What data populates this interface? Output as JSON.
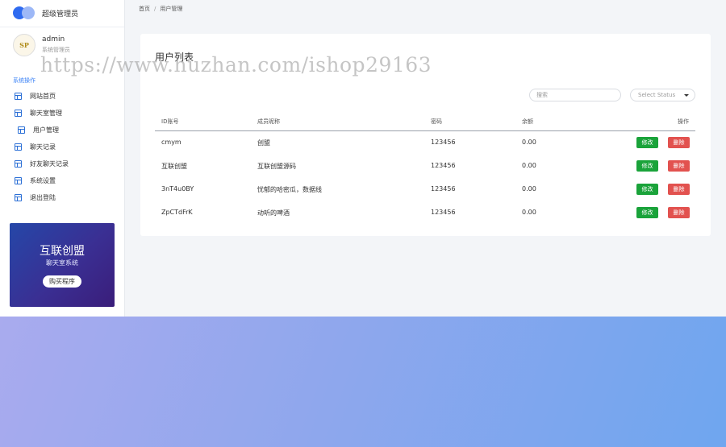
{
  "brand": {
    "title": "超级管理员"
  },
  "user": {
    "avatar_text": "SP",
    "name": "admin",
    "role": "系统管理员"
  },
  "sidebar": {
    "section_label": "系统操作",
    "items": [
      {
        "label": "网站首页",
        "icon": "layout-icon"
      },
      {
        "label": "聊天室管理",
        "icon": "layout-icon"
      },
      {
        "label": "用户管理",
        "icon": "layout-icon"
      },
      {
        "label": "聊天记录",
        "icon": "layout-icon"
      },
      {
        "label": "好友聊天记录",
        "icon": "layout-icon"
      },
      {
        "label": "系统设置",
        "icon": "layout-icon"
      },
      {
        "label": "退出登陆",
        "icon": "layout-icon"
      }
    ]
  },
  "promo": {
    "title": "互联创盟",
    "subtitle": "聊天室系统",
    "button": "购买程序"
  },
  "breadcrumb": {
    "home": "首页",
    "current": "用户管理"
  },
  "card": {
    "title": "用户列表"
  },
  "watermark": "https://www.huzhan.com/ishop29163",
  "search": {
    "placeholder": "搜索"
  },
  "status_select": {
    "value": "Select Status"
  },
  "table": {
    "columns": [
      "ID账号",
      "成员昵称",
      "密码",
      "余额",
      "操作"
    ],
    "rows": [
      {
        "id": "cmym",
        "nickname": "创盟",
        "password": "123456",
        "balance": "0.00"
      },
      {
        "id": "互联创盟",
        "nickname": "互联创盟源码",
        "password": "123456",
        "balance": "0.00"
      },
      {
        "id": "3nT4u0BY",
        "nickname": "忧郁的哈密瓜，数据线",
        "password": "123456",
        "balance": "0.00"
      },
      {
        "id": "ZpCTdFrK",
        "nickname": "动听的啤酒",
        "password": "123456",
        "balance": "0.00"
      }
    ],
    "edit_label": "修改",
    "delete_label": "删除"
  },
  "colors": {
    "accent": "#2f6bf0",
    "edit": "#1aa33a",
    "delete": "#e2524f"
  }
}
